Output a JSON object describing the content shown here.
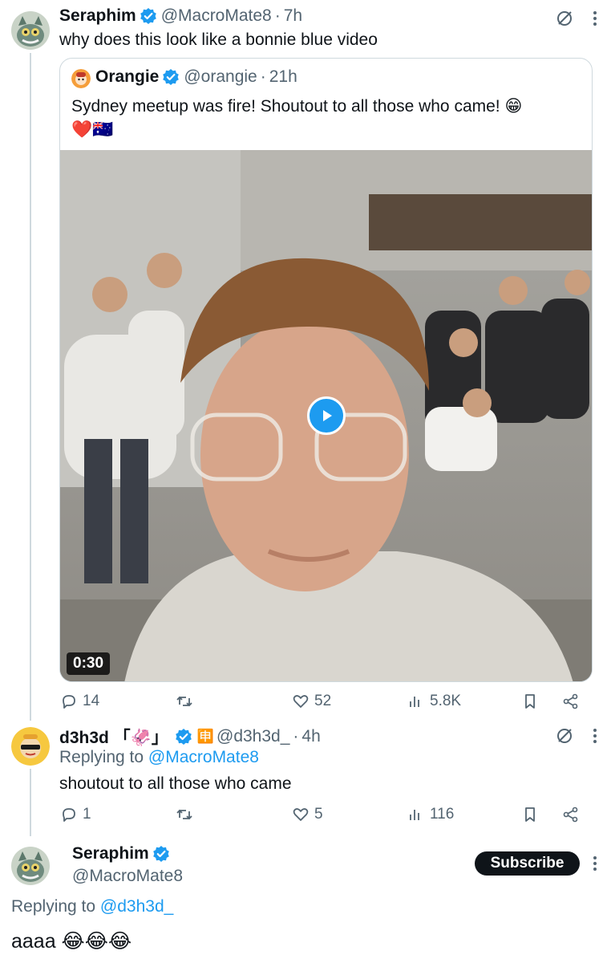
{
  "tweet1": {
    "name": "Seraphim",
    "handle": "@MacroMate8",
    "time": "7h",
    "text": "why does this look like a bonnie blue video"
  },
  "quote": {
    "name": "Orangie",
    "handle": "@orangie",
    "time": "21h",
    "text_line1": "Sydney meetup was fire! Shoutout to all those who came! 😁",
    "text_line2": "❤️🇦🇺",
    "video_duration": "0:30"
  },
  "tweet1_actions": {
    "replies": "14",
    "retweets": "",
    "likes": "52",
    "views": "5.8K"
  },
  "tweet2": {
    "name": "d3h3d 「🦑」",
    "handle_icon": "🈸",
    "handle": "@d3h3d_",
    "time": "4h",
    "replying_prefix": "Replying to",
    "replying_to": "@MacroMate8",
    "text": "shoutout to all those who came"
  },
  "tweet2_actions": {
    "replies": "1",
    "retweets": "",
    "likes": "5",
    "views": "116"
  },
  "tweet3": {
    "name": "Seraphim",
    "handle": "@MacroMate8",
    "subscribe_label": "Subscribe",
    "replying_prefix": "Replying to",
    "replying_to": "@d3h3d_",
    "text": "aaaa 😂😂😂"
  },
  "colors": {
    "accent": "#1d9bf0",
    "text": "#0f1419",
    "muted": "#536471",
    "border": "#cfd9de"
  },
  "icons": [
    "verified-badge-icon",
    "grok-icon",
    "more-icon",
    "reply-icon",
    "retweet-icon",
    "like-icon",
    "views-icon",
    "bookmark-icon",
    "share-icon",
    "play-icon"
  ]
}
